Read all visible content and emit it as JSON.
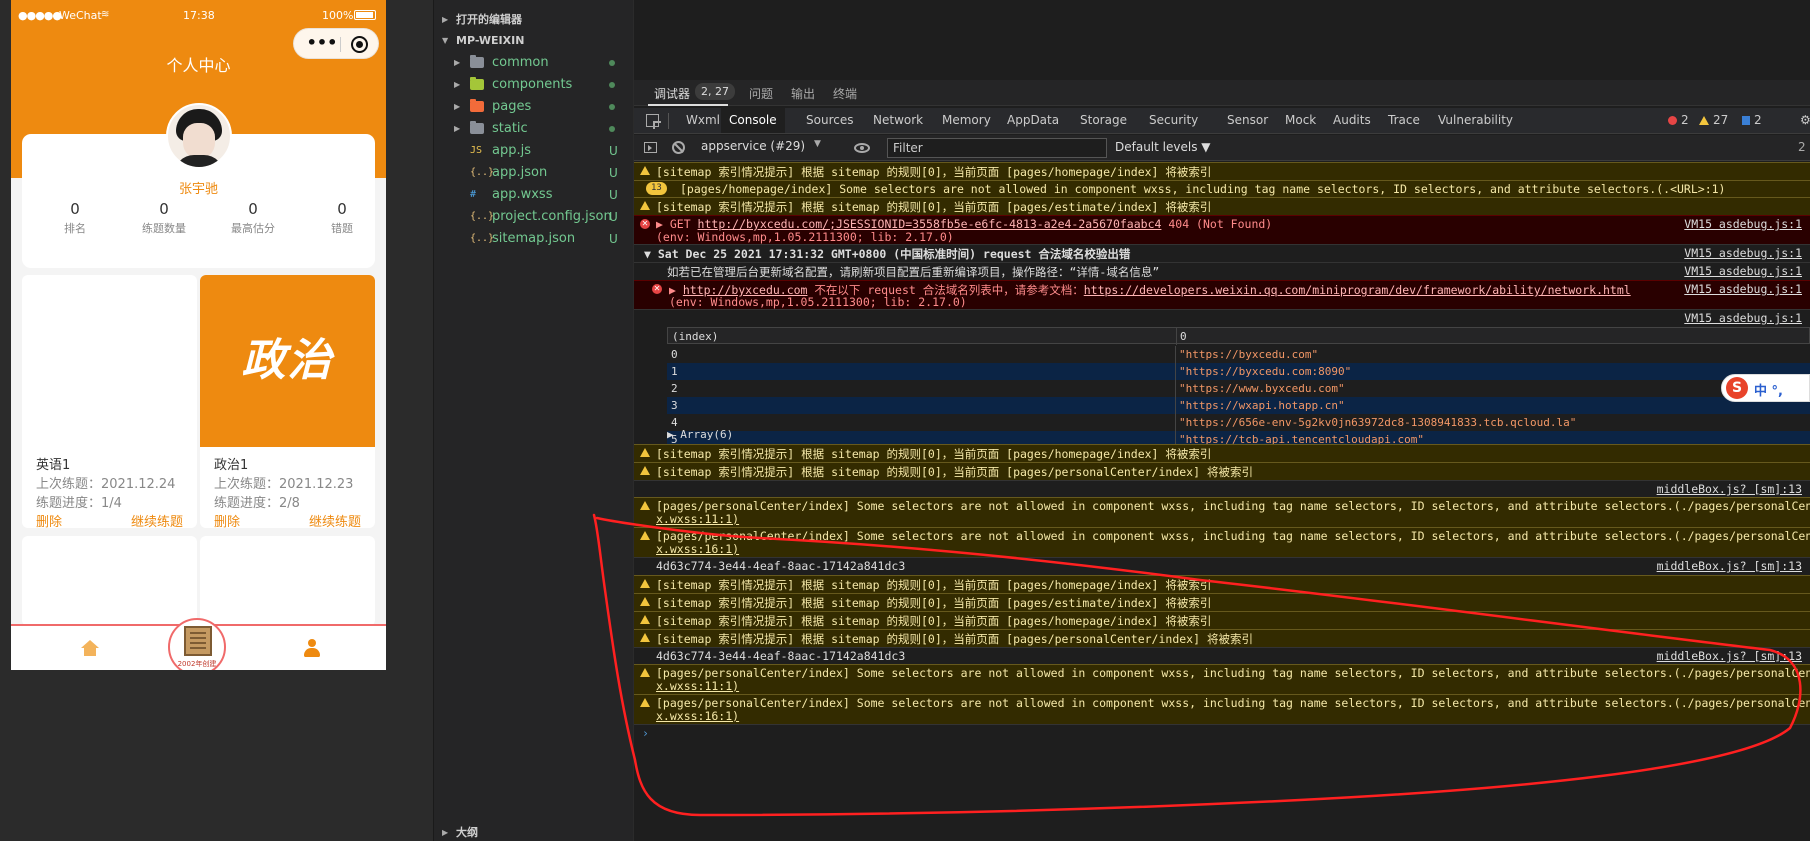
{
  "simulator": {
    "status": {
      "signal": "●●●●●",
      "carrier": "WeChat",
      "wifi": "≋",
      "time": "17:38",
      "battery": "100%"
    },
    "capsule": {
      "more": "•••"
    },
    "title": "个人中心",
    "user": {
      "name": "张宇驰"
    },
    "stats": [
      {
        "value": "0",
        "label": "排名"
      },
      {
        "value": "0",
        "label": "练题数量"
      },
      {
        "value": "0",
        "label": "最高估分"
      },
      {
        "value": "0",
        "label": "错题"
      }
    ],
    "courses": [
      {
        "cover": "",
        "name": "英语1",
        "last": "上次练题：2021.12.24",
        "progress": "练题进度：1/4",
        "delete": "删除",
        "continue": "继续练题"
      },
      {
        "cover": "政治",
        "name": "政治1",
        "last": "上次练题：2021.12.23",
        "progress": "练题进度：2/8",
        "delete": "删除",
        "continue": "继续练题"
      }
    ],
    "tabbar": {
      "center_label": "2002年创建"
    }
  },
  "explorer": {
    "open_editors": "打开的编辑器",
    "project": "MP-WEIXIN",
    "folders": [
      {
        "name": "common"
      },
      {
        "name": "components"
      },
      {
        "name": "pages"
      },
      {
        "name": "static"
      }
    ],
    "files": [
      {
        "icon": "JS",
        "name": "app.js",
        "status": "U"
      },
      {
        "icon": "{..}",
        "name": "app.json",
        "status": "U"
      },
      {
        "icon": "#",
        "name": "app.wxss",
        "status": "U"
      },
      {
        "icon": "{..}",
        "name": "project.config.json",
        "status": "U"
      },
      {
        "icon": "{..}",
        "name": "sitemap.json",
        "status": "U"
      }
    ],
    "outline": "大纲"
  },
  "devtools": {
    "panel_tabs": {
      "debugger": "调试器",
      "badge": "2, 27",
      "issues": "问题",
      "output": "输出",
      "terminal": "终端"
    },
    "tabs": [
      "Wxml",
      "Console",
      "Sources",
      "Network",
      "Memory",
      "AppData",
      "Storage",
      "Security",
      "Sensor",
      "Mock",
      "Audits",
      "Trace",
      "Vulnerability"
    ],
    "counts": {
      "errors": "2",
      "warnings": "27",
      "info": "2"
    },
    "toolbar": {
      "context": "appservice (#29)",
      "filter_placeholder": "Filter",
      "levels": "Default levels ▼",
      "hidden": "2"
    },
    "messages": {
      "m1": "[sitemap 索引情况提示] 根据 sitemap 的规则[0]，当前页面 [pages/homepage/index] 将被索引",
      "m2_badge": "13",
      "m2": "[pages/homepage/index] Some selectors are not allowed in component wxss, including tag name selectors, ID selectors, and attribute selectors.(.<URL>:1)",
      "m3": "[sitemap 索引情况提示] 根据 sitemap 的规则[0]，当前页面 [pages/estimate/index] 将被索引",
      "m4a": "▶ GET ",
      "m4_link": "http://byxcedu.com/;JSESSIONID=3558fb5e-e6fc-4813-a2e4-2a5670faabc4",
      "m4b": " 404 (Not Found)",
      "m4_env": "(env: Windows,mp,1.05.2111300; lib: 2.17.0)",
      "m4_src": "VM15 asdebug.js:1",
      "m5": "▼ Sat Dec 25 2021 17:31:32 GMT+0800 (中国标准时间) request 合法域名校验出错",
      "m5_src": "VM15 asdebug.js:1",
      "m6": "如若已在管理后台更新域名配置，请刷新项目配置后重新编译项目，操作路径：“详情-域名信息”",
      "m6_src": "VM15 asdebug.js:1",
      "m7_link": "http://byxcedu.com",
      "m7a": " 不在以下 request 合法域名列表中，请参考文档：",
      "m7_doc": "https://developers.weixin.qq.com/miniprogram/dev/framework/ability/network.html",
      "m7_env": "(env: Windows,mp,1.05.2111300; lib: 2.17.0)",
      "m7_src": "VM15 asdebug.js:1",
      "m8_src": "VM15 asdebug.js:1",
      "table_headers": [
        "(index)",
        "0"
      ],
      "table_rows": [
        [
          "0",
          "\"https://byxcedu.com\""
        ],
        [
          "1",
          "\"https://byxcedu.com:8090\""
        ],
        [
          "2",
          "\"https://www.byxcedu.com\""
        ],
        [
          "3",
          "\"https://wxapi.hotapp.cn\""
        ],
        [
          "4",
          "\"https://656e-env-5g2kv0jn63972dc8-1308941833.tcb.qcloud.la\""
        ],
        [
          "5",
          "\"https://tcb-api.tencentcloudapi.com\""
        ]
      ],
      "array": "▶ Array(6)",
      "m9": "[sitemap 索引情况提示] 根据 sitemap 的规则[0]，当前页面 [pages/homepage/index] 将被索引",
      "m10": "[sitemap 索引情况提示] 根据 sitemap 的规则[0]，当前页面 [pages/personalCenter/index] 将被索引",
      "m11_src": "middleBox.js? [sm]:13",
      "m12": "[pages/personalCenter/index] Some selectors are not allowed in component wxss, including tag name selectors, ID selectors, and attribute selectors.(./pages/personalCenter/bott",
      "m12b": "x.wxss:11:1)",
      "m13": "[pages/personalCenter/index] Some selectors are not allowed in component wxss, including tag name selectors, ID selectors, and attribute selectors.(./pages/personalCenter/midd",
      "m13b": "x.wxss:16:1)",
      "m14": "4d63c774-3e44-4eaf-8aac-17142a841dc3",
      "m14_src": "middleBox.js? [sm]:13",
      "m15": "[sitemap 索引情况提示] 根据 sitemap 的规则[0]，当前页面 [pages/homepage/index] 将被索引",
      "m16": "[sitemap 索引情况提示] 根据 sitemap 的规则[0]，当前页面 [pages/estimate/index] 将被索引",
      "m17": "[sitemap 索引情况提示] 根据 sitemap 的规则[0]，当前页面 [pages/homepage/index] 将被索引",
      "m18": "[sitemap 索引情况提示] 根据 sitemap 的规则[0]，当前页面 [pages/personalCenter/index] 将被索引",
      "m19": "4d63c774-3e44-4eaf-8aac-17142a841dc3",
      "m19_src": "middleBox.js? [sm]:13",
      "m20": "[pages/personalCenter/index] Some selectors are not allowed in component wxss, including tag name selectors, ID selectors, and attribute selectors.(./pages/personalCenter/bott",
      "m20b": "x.wxss:11:1)",
      "m21": "[pages/personalCenter/index] Some selectors are not allowed in component wxss, including tag name selectors, ID selectors, and attribute selectors.(./pages/personalCenter/midd",
      "m21b": "x.wxss:16:1)",
      "prompt": "›"
    },
    "ime": {
      "logo": "S",
      "text": "中 °,"
    }
  },
  "colors": {
    "brand": "#ee8a10",
    "warning_bg": "#332b00",
    "error_bg": "#290000",
    "annotation": "#ff2020"
  }
}
